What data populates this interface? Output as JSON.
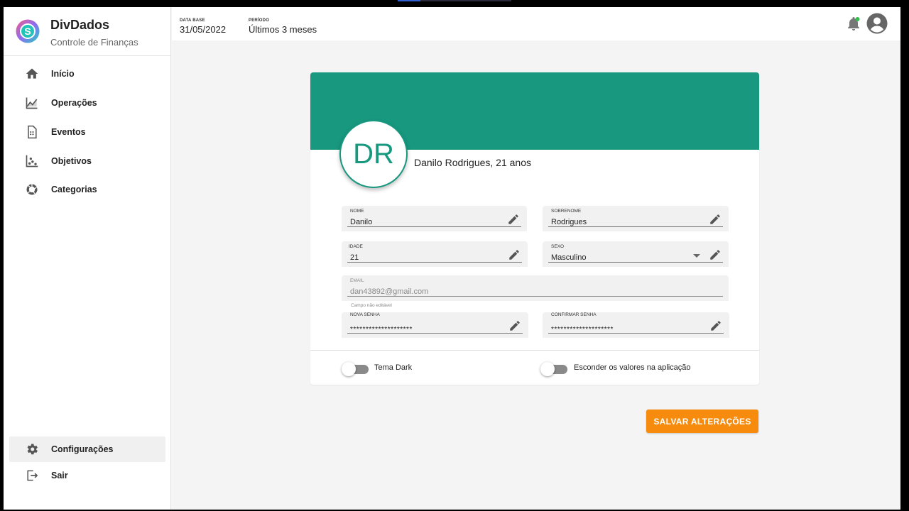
{
  "brand": {
    "name": "DivDados",
    "subtitle": "Controle de Finanças"
  },
  "sidebar": {
    "items": [
      {
        "label": "Início",
        "icon": "home-icon"
      },
      {
        "label": "Operações",
        "icon": "chart-line-icon"
      },
      {
        "label": "Eventos",
        "icon": "document-icon"
      },
      {
        "label": "Objetivos",
        "icon": "scatter-icon"
      },
      {
        "label": "Categorias",
        "icon": "donut-icon"
      }
    ],
    "bottom": [
      {
        "label": "Configurações",
        "icon": "gear-icon",
        "active": true
      },
      {
        "label": "Sair",
        "icon": "logout-icon"
      }
    ]
  },
  "topbar": {
    "data_base_label": "DATA BASE",
    "data_base_value": "31/05/2022",
    "periodo_label": "PERÍODO",
    "periodo_value": "Últimos 3 meses"
  },
  "profile": {
    "initials": "DR",
    "display_name": "Danilo Rodrigues, 21 anos",
    "accent_color": "#18987f"
  },
  "form": {
    "nome": {
      "label": "NOME",
      "value": "Danilo"
    },
    "sobrenome": {
      "label": "SOBRENOME",
      "value": "Rodrigues"
    },
    "idade": {
      "label": "IDADE",
      "value": "21"
    },
    "sexo": {
      "label": "SEXO",
      "value": "Masculino"
    },
    "email": {
      "label": "EMAIL",
      "value": "dan43892@gmail.com",
      "hint": "Campo não editável"
    },
    "nova_senha": {
      "label": "NOVA SENHA",
      "value": "********************"
    },
    "confirmar_senha": {
      "label": "CONFIRMAR SENHA",
      "value": "********************"
    }
  },
  "toggles": {
    "tema_dark": {
      "label": "Tema Dark",
      "on": false
    },
    "esconder": {
      "label": "Esconder os valores na aplicação",
      "on": false
    }
  },
  "actions": {
    "save_label": "SALVAR ALTERAÇÕES",
    "save_color": "#f68b0e"
  }
}
